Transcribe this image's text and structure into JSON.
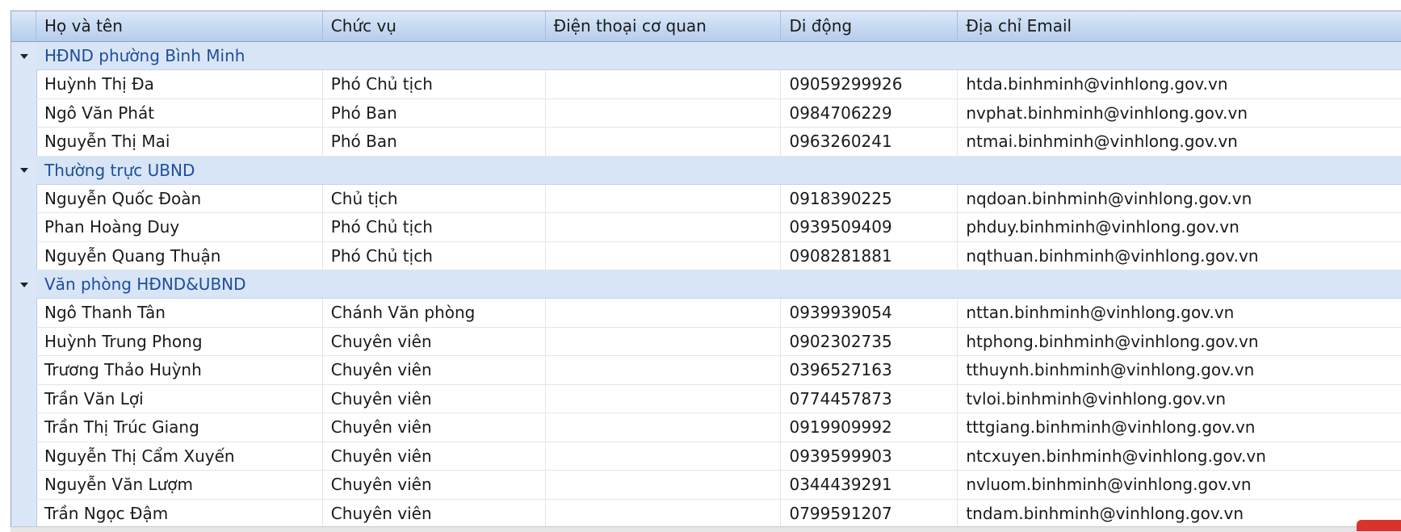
{
  "columns": {
    "name": "Họ và tên",
    "position": "Chức vụ",
    "office_phone": "Điện thoại cơ quan",
    "mobile": "Di động",
    "email": "Địa chỉ Email"
  },
  "groups": [
    {
      "title": "HĐND phường Bình Minh",
      "rows": [
        {
          "name": "Huỳnh Thị Đa",
          "position": "Phó Chủ tịch",
          "office_phone": "",
          "mobile": "09059299926",
          "email": "htda.binhminh@vinhlong.gov.vn"
        },
        {
          "name": "Ngô Văn Phát",
          "position": "Phó Ban",
          "office_phone": "",
          "mobile": "0984706229",
          "email": "nvphat.binhminh@vinhlong.gov.vn"
        },
        {
          "name": "Nguyễn Thị Mai",
          "position": "Phó Ban",
          "office_phone": "",
          "mobile": "0963260241",
          "email": "ntmai.binhminh@vinhlong.gov.vn"
        }
      ]
    },
    {
      "title": "Thường trực UBND",
      "rows": [
        {
          "name": "Nguyễn Quốc Đoàn",
          "position": "Chủ tịch",
          "office_phone": "",
          "mobile": "0918390225",
          "email": "nqdoan.binhminh@vinhlong.gov.vn"
        },
        {
          "name": "Phan Hoàng Duy",
          "position": "Phó Chủ tịch",
          "office_phone": "",
          "mobile": "0939509409",
          "email": "phduy.binhminh@vinhlong.gov.vn"
        },
        {
          "name": "Nguyễn Quang Thuận",
          "position": "Phó Chủ tịch",
          "office_phone": "",
          "mobile": "0908281881",
          "email": "nqthuan.binhminh@vinhlong.gov.vn"
        }
      ]
    },
    {
      "title": "Văn phòng HĐND&UBND",
      "rows": [
        {
          "name": "Ngô Thanh Tân",
          "position": "Chánh Văn phòng",
          "office_phone": "",
          "mobile": "0939939054",
          "email": "nttan.binhminh@vinhlong.gov.vn"
        },
        {
          "name": "Huỳnh Trung Phong",
          "position": "Chuyên viên",
          "office_phone": "",
          "mobile": "0902302735",
          "email": "htphong.binhminh@vinhlong.gov.vn"
        },
        {
          "name": "Trương Thảo Huỳnh",
          "position": "Chuyên viên",
          "office_phone": "",
          "mobile": "0396527163",
          "email": "tthuynh.binhminh@vinhlong.gov.vn"
        },
        {
          "name": "Trần Văn Lợi",
          "position": "Chuyên viên",
          "office_phone": "",
          "mobile": "0774457873",
          "email": "tvloi.binhminh@vinhlong.gov.vn"
        },
        {
          "name": "Trần Thị Trúc Giang",
          "position": "Chuyên viên",
          "office_phone": "",
          "mobile": "0919909992",
          "email": "tttgiang.binhminh@vinhlong.gov.vn"
        },
        {
          "name": "Nguyễn Thị Cẩm Xuyến",
          "position": "Chuyên viên",
          "office_phone": "",
          "mobile": "0939599903",
          "email": "ntcxuyen.binhminh@vinhlong.gov.vn"
        },
        {
          "name": "Nguyễn Văn Lượm",
          "position": "Chuyên viên",
          "office_phone": "",
          "mobile": "0344439291",
          "email": "nvluom.binhminh@vinhlong.gov.vn"
        },
        {
          "name": "Trần Ngọc Đậm",
          "position": "Chuyên viên",
          "office_phone": "",
          "mobile": "0799591207",
          "email": "tndam.binhminh@vinhlong.gov.vn"
        }
      ]
    }
  ],
  "colors": {
    "group_text": "#1f4e9a",
    "group_bg": "#d8e5f6",
    "header_bg": "#c9dcf3"
  }
}
